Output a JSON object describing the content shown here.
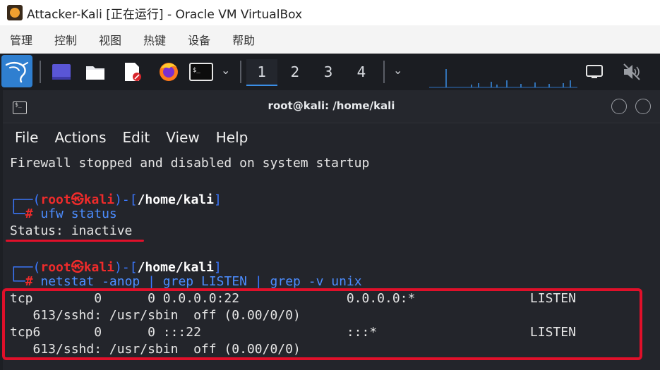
{
  "window": {
    "title": "Attacker-Kali [正在运行] - Oracle VM VirtualBox"
  },
  "menubar": {
    "items": [
      "管理",
      "控制",
      "视图",
      "热键",
      "设备",
      "帮助"
    ]
  },
  "panel": {
    "workspaces": [
      "1",
      "2",
      "3",
      "4"
    ],
    "active_workspace": "1"
  },
  "terminal": {
    "title": "root@kali: /home/kali",
    "menu": [
      "File",
      "Actions",
      "Edit",
      "View",
      "Help"
    ],
    "lines": {
      "fw": "Firewall stopped and disabled on system startup",
      "p1_user": "root",
      "p1_host": "kali",
      "p1_path": "/home/kali",
      "c1": "ufw status",
      "status": "Status: inactive",
      "p2_user": "root",
      "p2_host": "kali",
      "p2_path": "/home/kali",
      "c2_a": "netstat -anop",
      "c2_b": "grep LISTEN",
      "c2_c": "grep -v unix",
      "r1": "tcp        0      0 0.0.0.0:22              0.0.0.0:*               LISTEN",
      "r1b": "   613/sshd: /usr/sbin  off (0.00/0/0)",
      "r2": "tcp6       0      0 :::22                   :::*                    LISTEN",
      "r2b": "   613/sshd: /usr/sbin  off (0.00/0/0)"
    }
  },
  "colors": {
    "accent": "#3a8ee6",
    "prompt_red": "#ef2b2b",
    "prompt_blue": "#3b78ff",
    "annotation": "#e0102a"
  }
}
